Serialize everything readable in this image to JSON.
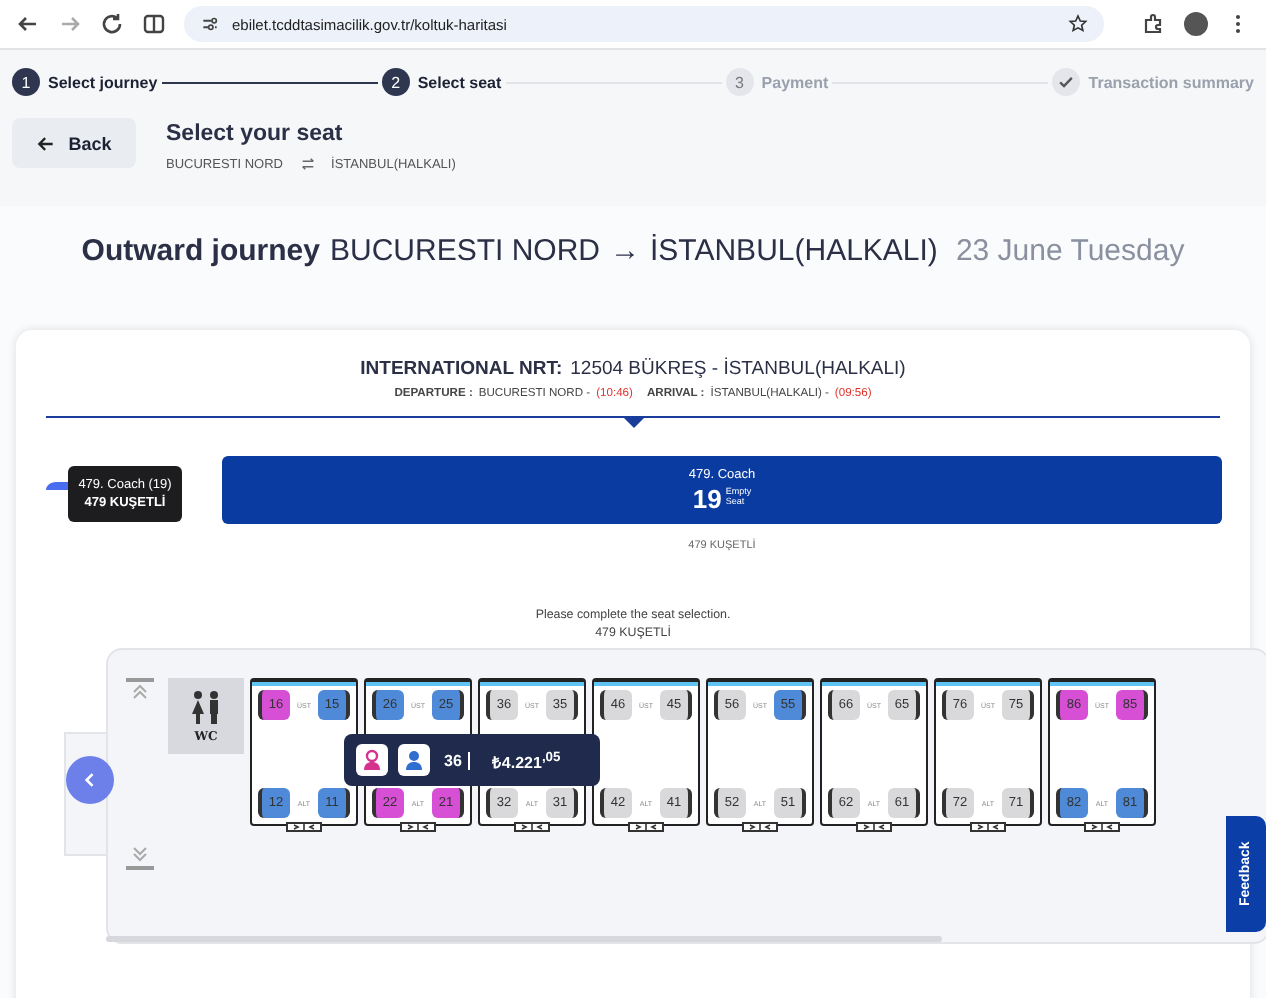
{
  "browser": {
    "url": "ebilet.tcddtasimacilik.gov.tr/koltuk-haritasi"
  },
  "steps": [
    {
      "kind": "number",
      "number": "1",
      "label": "Select journey",
      "active": true
    },
    {
      "kind": "number",
      "number": "2",
      "label": "Select seat",
      "active": true
    },
    {
      "kind": "number",
      "number": "3",
      "label": "Payment",
      "active": false
    },
    {
      "kind": "check",
      "label": "Transaction summary",
      "active": false
    }
  ],
  "header": {
    "back": "Back",
    "title": "Select your seat",
    "from": "BUCURESTI NORD",
    "to": "İSTANBUL(HALKALI)"
  },
  "journey": {
    "label": "Outward journey",
    "from": "BUCURESTI NORD",
    "arrow": "→",
    "to": "İSTANBUL(HALKALI)",
    "date": "23 June Tuesday"
  },
  "train": {
    "name_label": "INTERNATIONAL NRT:",
    "name": "12504 BÜKREŞ - İSTANBUL(HALKALI)",
    "departure_label": "DEPARTURE :",
    "departure_station": "BUCURESTI NORD -",
    "departure_time": "(10:46)",
    "arrival_label": "ARRIVAL :",
    "arrival_station": "İSTANBUL(HALKALI) -",
    "arrival_time": "(09:56)"
  },
  "coach_tooltip": {
    "title": "479. Coach (19)",
    "type": "479 KUŞETLİ"
  },
  "coaches": [
    {
      "title": "479. Coach",
      "count": "19",
      "count_label_1": "Empty",
      "count_label_2": "Seat",
      "type": "479 KUŞETLİ",
      "selected": true
    }
  ],
  "notice": {
    "message": "Please complete the seat selection.",
    "coach": "479 KUŞETLİ"
  },
  "wc_label": "WC",
  "compartments": [
    {
      "upper_label": "ÜST",
      "lower_label": "ALT",
      "seats": [
        {
          "number": "16",
          "color": "#d64fd4"
        },
        {
          "number": "15",
          "color": "#4f8ad8"
        },
        {
          "number": "12",
          "color": "#4f8ad8"
        },
        {
          "number": "11",
          "color": "#4f8ad8"
        }
      ]
    },
    {
      "upper_label": "ÜST",
      "lower_label": "ALT",
      "seats": [
        {
          "number": "26",
          "color": "#4f8ad8"
        },
        {
          "number": "25",
          "color": "#4f8ad8"
        },
        {
          "number": "22",
          "color": "#d64fd4"
        },
        {
          "number": "21",
          "color": "#d64fd4"
        }
      ]
    },
    {
      "upper_label": "ÜST",
      "lower_label": "ALT",
      "seats": [
        {
          "number": "36",
          "color": "#d9d9dc"
        },
        {
          "number": "35",
          "color": "#d9d9dc"
        },
        {
          "number": "32",
          "color": "#d9d9dc"
        },
        {
          "number": "31",
          "color": "#d9d9dc"
        }
      ]
    },
    {
      "upper_label": "ÜST",
      "lower_label": "ALT",
      "seats": [
        {
          "number": "46",
          "color": "#d9d9dc"
        },
        {
          "number": "45",
          "color": "#d9d9dc"
        },
        {
          "number": "42",
          "color": "#d9d9dc"
        },
        {
          "number": "41",
          "color": "#d9d9dc"
        }
      ]
    },
    {
      "upper_label": "ÜST",
      "lower_label": "ALT",
      "seats": [
        {
          "number": "56",
          "color": "#d9d9dc"
        },
        {
          "number": "55",
          "color": "#4f8ad8"
        },
        {
          "number": "52",
          "color": "#d9d9dc"
        },
        {
          "number": "51",
          "color": "#d9d9dc"
        }
      ]
    },
    {
      "upper_label": "ÜST",
      "lower_label": "ALT",
      "seats": [
        {
          "number": "66",
          "color": "#d9d9dc"
        },
        {
          "number": "65",
          "color": "#d9d9dc"
        },
        {
          "number": "62",
          "color": "#d9d9dc"
        },
        {
          "number": "61",
          "color": "#d9d9dc"
        }
      ]
    },
    {
      "upper_label": "ÜST",
      "lower_label": "ALT",
      "seats": [
        {
          "number": "76",
          "color": "#d9d9dc"
        },
        {
          "number": "75",
          "color": "#d9d9dc"
        },
        {
          "number": "72",
          "color": "#d9d9dc"
        },
        {
          "number": "71",
          "color": "#d9d9dc"
        }
      ]
    },
    {
      "upper_label": "ÜST",
      "lower_label": "ALT",
      "seats": [
        {
          "number": "86",
          "color": "#d64fd4"
        },
        {
          "number": "85",
          "color": "#d64fd4"
        },
        {
          "number": "82",
          "color": "#4f8ad8"
        },
        {
          "number": "81",
          "color": "#4f8ad8"
        }
      ]
    }
  ],
  "seat_tooltip": {
    "seat": "36",
    "price": "₺4.221$^{,05}$"
  },
  "feedback": "Feedback"
}
